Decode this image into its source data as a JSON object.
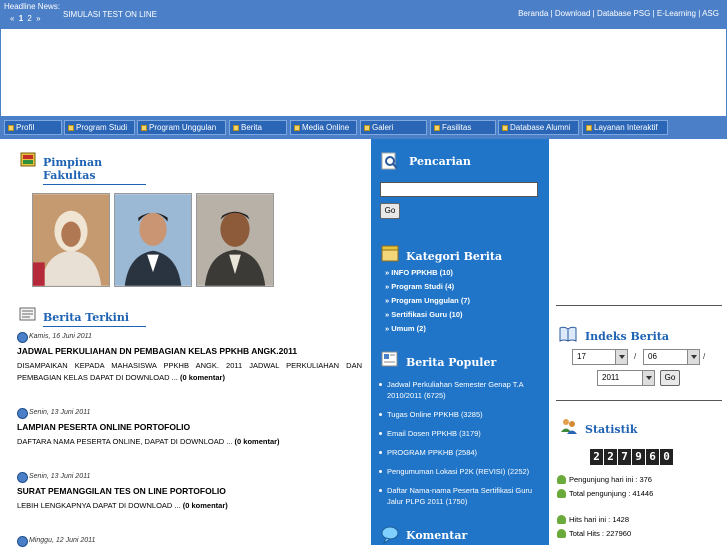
{
  "topbar": {
    "headline_label": "Headline News:",
    "pager": {
      "prev": "«",
      "page1": "1",
      "page2": "2",
      "next": "»"
    },
    "headline_text": "SIMULASI TEST ON LINE",
    "links": [
      "Beranda",
      "Download",
      "Database PSG",
      "E-Learning",
      "ASG"
    ],
    "separator": " | "
  },
  "nav": {
    "items": [
      "Profil",
      "Program Studi",
      "Program Unggulan",
      "Berita",
      "Media Online",
      "Galeri",
      "Fasilitas",
      "Database Alumni",
      "Layanan Interaktif"
    ]
  },
  "left": {
    "pimpinan_title": "Pimpinan Fakultas",
    "berita_title": "Berita Terkini",
    "news": [
      {
        "date": "Kamis, 16 Juni 2011",
        "title": "JADWAL PERKULIAHAN DN PEMBAGIAN KELAS PPKHB ANGK.2011",
        "body": "DISAMPAIKAN KEPADA MAHASISWA PPKHB ANGK. 2011 JADWAL PERKULIAHAN DAN PEMBAGIAN KELAS DAPAT DI DOWNLOAD ... ",
        "comment": "(0 komentar)"
      },
      {
        "date": "Senin, 13 Juni 2011",
        "title": "LAMPIAN PESERTA ONLINE PORTOFOLIO",
        "body": "DAFTARA NAMA PESERTA ONLINE, DAPAT DI DOWNLOAD ... ",
        "comment": "(0 komentar)"
      },
      {
        "date": "Senin, 13 Juni 2011",
        "title": "SURAT PEMANGGILAN TES ON LINE PORTOFOLIO",
        "body": "LEBIH LENGKAPNYA DAPAT DI DOWNLOAD ... ",
        "comment": "(0 komentar)"
      },
      {
        "date": "Minggu, 12 Juni 2011",
        "title": "",
        "body": "",
        "comment": ""
      }
    ]
  },
  "middle": {
    "pencarian_title": "Pencarian",
    "search_value": "",
    "go_label": "Go",
    "kategori_title": "Kategori Berita",
    "categories": [
      "» INFO PPKHB (10)",
      "» Program Studi (4)",
      "» Program Unggulan (7)",
      "» Sertifikasi Guru (10)",
      "» Umum (2)"
    ],
    "populer_title": "Berita Populer",
    "popular": [
      {
        "text": "Jadwal Perkuliahan Semester Genap T.A 2010/2011",
        "count": "(6725)"
      },
      {
        "text": "Tugas Online PPKHB",
        "count": "(3285)"
      },
      {
        "text": "Email Dosen PPKHB",
        "count": "(3179)"
      },
      {
        "text": "PROGRAM PPKHB",
        "count": "(2584)"
      },
      {
        "text": "Pengumuman Lokasi P2K (REVISI)",
        "count": "(2252)"
      },
      {
        "text": "Daftar Nama-nama Peserta Sertifikasi Guru Jalur PLPG 2011",
        "count": "(1750)"
      }
    ],
    "komentar_title": "Komentar"
  },
  "right": {
    "indeks_title": "Indeks Berita",
    "day": "17",
    "month": "06",
    "year": "2011",
    "slash": "/",
    "go_label": "Go",
    "statistik_title": "Statistik",
    "counter_digits": [
      "2",
      "2",
      "7",
      "9",
      "6",
      "0"
    ],
    "stats": [
      "Pengunjung hari ini : 376",
      "Total pengunjung : 41446",
      "Hits hari ini : 1428",
      "Total Hits : 227960"
    ]
  },
  "colors": {
    "topbar": "#4b7fc7",
    "nav_item": "#2b66b6",
    "middle_bg": "#2175c8",
    "title_blue": "#1d62b3"
  }
}
